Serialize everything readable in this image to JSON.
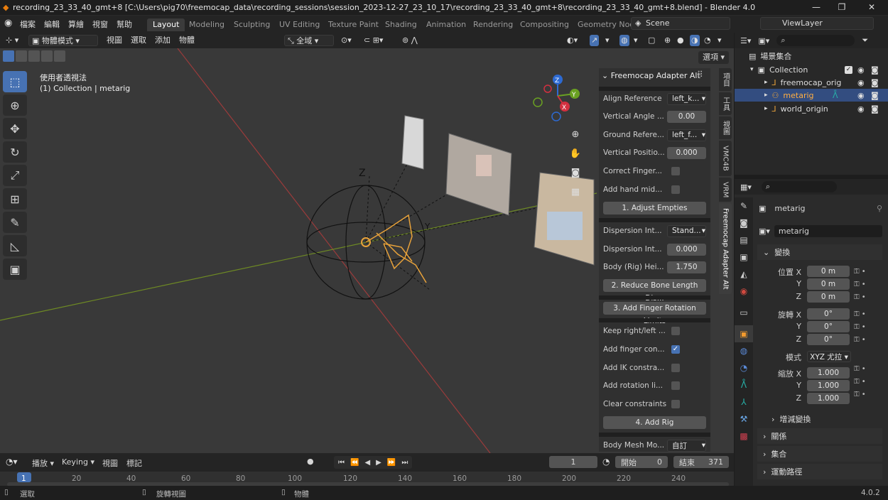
{
  "titlebar": {
    "title": "recording_23_33_40_gmt+8 [C:\\Users\\pig70\\freemocap_data\\recording_sessions\\session_2023-12-27_23_10_17\\recording_23_33_40_gmt+8\\recording_23_33_40_gmt+8.blend] - Blender 4.0",
    "minimize": "—",
    "maximize": "❐",
    "close": "✕"
  },
  "menus": [
    "檔案",
    "編輯",
    "算繪",
    "視窗",
    "幫助"
  ],
  "workspaces": [
    "Layout",
    "Modeling",
    "Sculpting",
    "UV Editing",
    "Texture Paint",
    "Shading",
    "Animation",
    "Rendering",
    "Compositing",
    "Geometry Noc"
  ],
  "scene": {
    "label": "Scene",
    "viewlayer": "ViewLayer"
  },
  "viewport_header": {
    "mode": "物體模式",
    "menus": [
      "視圖",
      "選取",
      "添加",
      "物體"
    ],
    "orientation": "全域",
    "options_label": "選項"
  },
  "viewport": {
    "view_name": "使用者透視法",
    "collection_info": "(1) Collection | metarig",
    "axis_labels": {
      "z": "Z",
      "y": "Y",
      "x": "X"
    }
  },
  "npanel": {
    "title": "Freemocap Adapter Alt",
    "rows": [
      {
        "label": "Align Reference",
        "value": "left_k...",
        "type": "dropdown"
      },
      {
        "label": "Vertical Angle ...",
        "value": "0.00",
        "type": "number"
      },
      {
        "label": "Ground Refere...",
        "value": "left_f...",
        "type": "dropdown"
      },
      {
        "label": "Vertical Positio...",
        "value": "0.000",
        "type": "number"
      },
      {
        "label": "Correct Finger...",
        "value": "",
        "type": "check"
      },
      {
        "label": "Add hand mid...",
        "value": "",
        "type": "check"
      }
    ],
    "btn1": "1. Adjust Empties",
    "rows2": [
      {
        "label": "Dispersion Int...",
        "value": "Stand...",
        "type": "dropdown"
      },
      {
        "label": "Dispersion Int...",
        "value": "0.000",
        "type": "number"
      },
      {
        "label": "Body (Rig) Hei...",
        "value": "1.750",
        "type": "number"
      }
    ],
    "btn2": "2. Reduce Bone Length Dis...",
    "btn3": "3. Add Finger Rotation Limits",
    "rows3": [
      {
        "label": "Keep right/left ...",
        "checked": false
      },
      {
        "label": "Add finger con...",
        "checked": true
      },
      {
        "label": "Add IK constra...",
        "checked": false
      },
      {
        "label": "Add rotation li...",
        "checked": false
      },
      {
        "label": "Clear constraints",
        "checked": false
      }
    ],
    "btn4": "4. Add Rig",
    "last_row": {
      "label": "Body Mesh Mo...",
      "value": "自訂"
    },
    "tabs": [
      "項目",
      "工具",
      "視圖",
      "VMC4B",
      "VRM",
      "Freemocap Adapter Alt"
    ]
  },
  "outliner": {
    "root": "場景集合",
    "collection": "Collection",
    "items": [
      "freemocap_orig",
      "metarig",
      "world_origin"
    ]
  },
  "properties": {
    "object_name": "metarig",
    "data_name": "metarig",
    "transform_title": "變換",
    "location_label": "位置 X",
    "rotation_label": "旋轉 X",
    "scale_label": "縮放 X",
    "axis_y": "Y",
    "axis_z": "Z",
    "location": [
      "0 m",
      "0 m",
      "0 m"
    ],
    "rotation": [
      "0°",
      "0°",
      "0°"
    ],
    "mode_label": "模式",
    "mode_value": "XYZ 尤拉",
    "scale": [
      "1.000",
      "1.000",
      "1.000"
    ],
    "delta": "增減變換",
    "sections": [
      "關係",
      "集合",
      "運動路徑"
    ]
  },
  "timeline": {
    "play_menu": "播放",
    "keying": "Keying",
    "view": "視圖",
    "marker": "標記",
    "current_frame": "1",
    "start_label": "開始",
    "start": "0",
    "end_label": "結束",
    "end": "371",
    "ticks": [
      "1",
      "20",
      "40",
      "60",
      "80",
      "100",
      "120",
      "140",
      "160",
      "180",
      "200",
      "220",
      "240"
    ]
  },
  "status": {
    "select": "選取",
    "rotate": "旋轉視圖",
    "object": "物體",
    "version": "4.0.2"
  }
}
